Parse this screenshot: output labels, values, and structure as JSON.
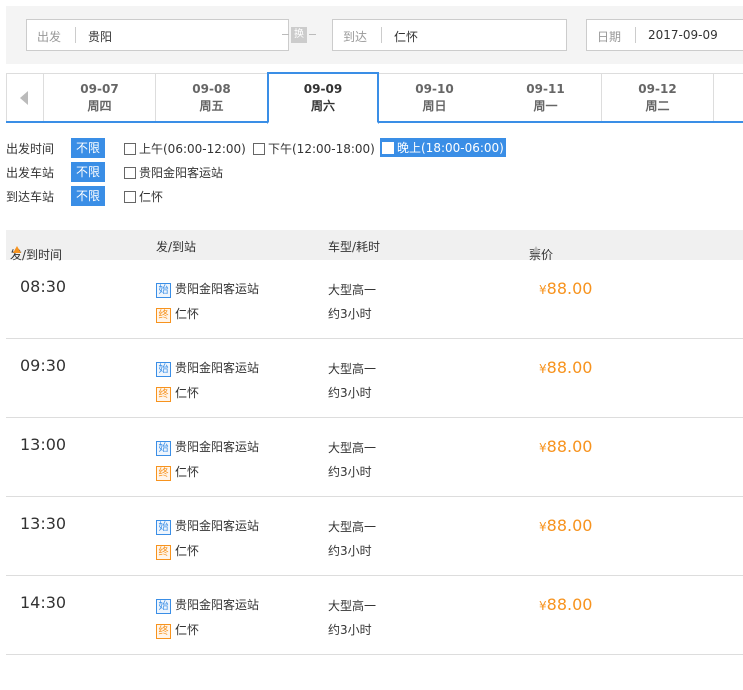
{
  "search": {
    "depart_label": "出发",
    "depart_value": "贵阳",
    "swap_label": "换",
    "arrive_label": "到达",
    "arrive_value": "仁怀",
    "date_label": "日期",
    "date_value": "2017-09-09"
  },
  "date_tabs": [
    {
      "date": "09-07",
      "weekday": "周四",
      "active": false
    },
    {
      "date": "09-08",
      "weekday": "周五",
      "active": false
    },
    {
      "date": "09-09",
      "weekday": "周六",
      "active": true
    },
    {
      "date": "09-10",
      "weekday": "周日",
      "active": false
    },
    {
      "date": "09-11",
      "weekday": "周一",
      "active": false
    },
    {
      "date": "09-12",
      "weekday": "周二",
      "active": false
    }
  ],
  "filters": {
    "depart_time": {
      "label": "出发时间",
      "all": "不限",
      "options": [
        "上午(06:00-12:00)",
        "下午(12:00-18:00)",
        "晚上(18:00-06:00)"
      ]
    },
    "depart_station": {
      "label": "出发车站",
      "all": "不限",
      "options": [
        "贵阳金阳客运站"
      ]
    },
    "arrive_station": {
      "label": "到达车站",
      "all": "不限",
      "options": [
        "仁怀"
      ]
    }
  },
  "table": {
    "headers": {
      "time": "发/到时间",
      "station": "发/到站",
      "type": "车型/耗时",
      "price": "票价"
    },
    "rows": [
      {
        "time": "08:30",
        "from": "贵阳金阳客运站",
        "to": "仁怀",
        "bus_type": "大型高一",
        "duration": "约3小时",
        "currency": "¥",
        "price": "88.00"
      },
      {
        "time": "09:30",
        "from": "贵阳金阳客运站",
        "to": "仁怀",
        "bus_type": "大型高一",
        "duration": "约3小时",
        "currency": "¥",
        "price": "88.00"
      },
      {
        "time": "13:00",
        "from": "贵阳金阳客运站",
        "to": "仁怀",
        "bus_type": "大型高一",
        "duration": "约3小时",
        "currency": "¥",
        "price": "88.00"
      },
      {
        "time": "13:30",
        "from": "贵阳金阳客运站",
        "to": "仁怀",
        "bus_type": "大型高一",
        "duration": "约3小时",
        "currency": "¥",
        "price": "88.00"
      },
      {
        "time": "14:30",
        "from": "贵阳金阳客运站",
        "to": "仁怀",
        "bus_type": "大型高一",
        "duration": "约3小时",
        "currency": "¥",
        "price": "88.00"
      }
    ],
    "badges": {
      "start": "始",
      "end": "终"
    }
  },
  "colors": {
    "accent": "#3a8ee6",
    "price": "#f7931e"
  }
}
